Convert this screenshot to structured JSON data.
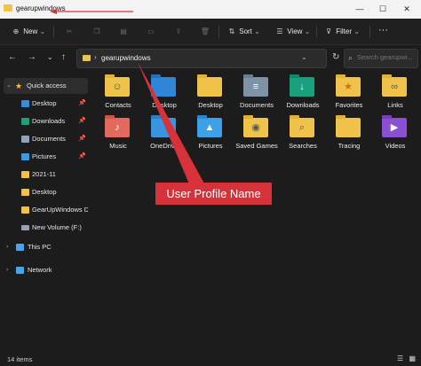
{
  "window": {
    "title": "gearupwindows"
  },
  "titlebar": {
    "minimize": "—",
    "maximize": "☐",
    "close": "✕"
  },
  "toolbar": {
    "new_label": "New",
    "new_chevron": "⌄",
    "sort_label": "Sort",
    "view_label": "View",
    "filter_label": "Filter",
    "more_label": "···"
  },
  "nav": {
    "back": "←",
    "forward": "→",
    "down": "⌄",
    "up": "↑",
    "refresh": "↻"
  },
  "address": {
    "separator": "›",
    "path": "gearupwindows",
    "dropdown": "⌄"
  },
  "search": {
    "placeholder": "Search gearupwi...",
    "icon": "⌕"
  },
  "sidebar": {
    "items": [
      {
        "label": "Quick access",
        "icon": "star-icon",
        "pinned": false,
        "selected": true
      },
      {
        "label": "Desktop",
        "icon": "desktop-icon",
        "pinned": true
      },
      {
        "label": "Downloads",
        "icon": "download-icon",
        "pinned": true
      },
      {
        "label": "Documents",
        "icon": "document-icon",
        "pinned": true
      },
      {
        "label": "Pictures",
        "icon": "picture-icon",
        "pinned": true
      },
      {
        "label": "2021-11",
        "icon": "folder-icon",
        "pinned": false
      },
      {
        "label": "Desktop",
        "icon": "folder-icon",
        "pinned": false
      },
      {
        "label": "GearUpWindows D",
        "icon": "folder-icon",
        "pinned": false
      },
      {
        "label": "New Volume (F:)",
        "icon": "drive-icon",
        "pinned": false
      },
      {
        "label": "This PC",
        "icon": "pc-icon",
        "pinned": false
      },
      {
        "label": "Network",
        "icon": "network-icon",
        "pinned": false
      }
    ]
  },
  "files": [
    {
      "name": "Contacts",
      "icon": "contacts-folder-icon",
      "glyph": "☺"
    },
    {
      "name": "Desktop",
      "icon": "desktop-folder-icon",
      "glyph": ""
    },
    {
      "name": "Desktop",
      "icon": "folder-icon",
      "glyph": ""
    },
    {
      "name": "Documents",
      "icon": "documents-folder-icon",
      "glyph": "≡"
    },
    {
      "name": "Downloads",
      "icon": "downloads-folder-icon",
      "glyph": "↓"
    },
    {
      "name": "Favorites",
      "icon": "favorites-folder-icon",
      "glyph": "★"
    },
    {
      "name": "Links",
      "icon": "links-folder-icon",
      "glyph": "∞"
    },
    {
      "name": "Music",
      "icon": "music-folder-icon",
      "glyph": "♪"
    },
    {
      "name": "OneDrive",
      "icon": "onedrive-folder-icon",
      "glyph": ""
    },
    {
      "name": "Pictures",
      "icon": "pictures-folder-icon",
      "glyph": "▲"
    },
    {
      "name": "Saved Games",
      "icon": "saved-games-folder-icon",
      "glyph": "◉"
    },
    {
      "name": "Searches",
      "icon": "searches-folder-icon",
      "glyph": "⌕"
    },
    {
      "name": "Tracing",
      "icon": "folder-icon",
      "glyph": ""
    },
    {
      "name": "Videos",
      "icon": "videos-folder-icon",
      "glyph": "▶"
    }
  ],
  "status": {
    "count": "14 items"
  },
  "annotation": {
    "label": "User Profile Name"
  },
  "colors": {
    "folder": "#f0c24a",
    "accent": "#d7313a",
    "background": "#1c1c1c"
  }
}
